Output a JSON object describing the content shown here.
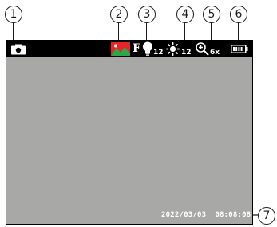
{
  "callouts": [
    "1",
    "2",
    "3",
    "4",
    "5",
    "6",
    "7"
  ],
  "status_bar": {
    "mode_icon": "camera-icon",
    "scene_icon": "picture-mode-icon",
    "flash_label": "F",
    "flash_icon": "light-bulb-icon",
    "flash_level": "12",
    "brightness_icon": "sun-icon",
    "brightness_level": "12",
    "zoom_icon": "zoom-in-icon",
    "zoom_level": "6x",
    "battery_icon": "battery-icon"
  },
  "screen": {
    "date": "2022/03/03",
    "time": "08:08:08"
  },
  "colors": {
    "screen_bg": "#a8a8a6",
    "status_bar_bg": "#000000",
    "picture_red": "#e8232a",
    "picture_green": "#2aa84a"
  }
}
